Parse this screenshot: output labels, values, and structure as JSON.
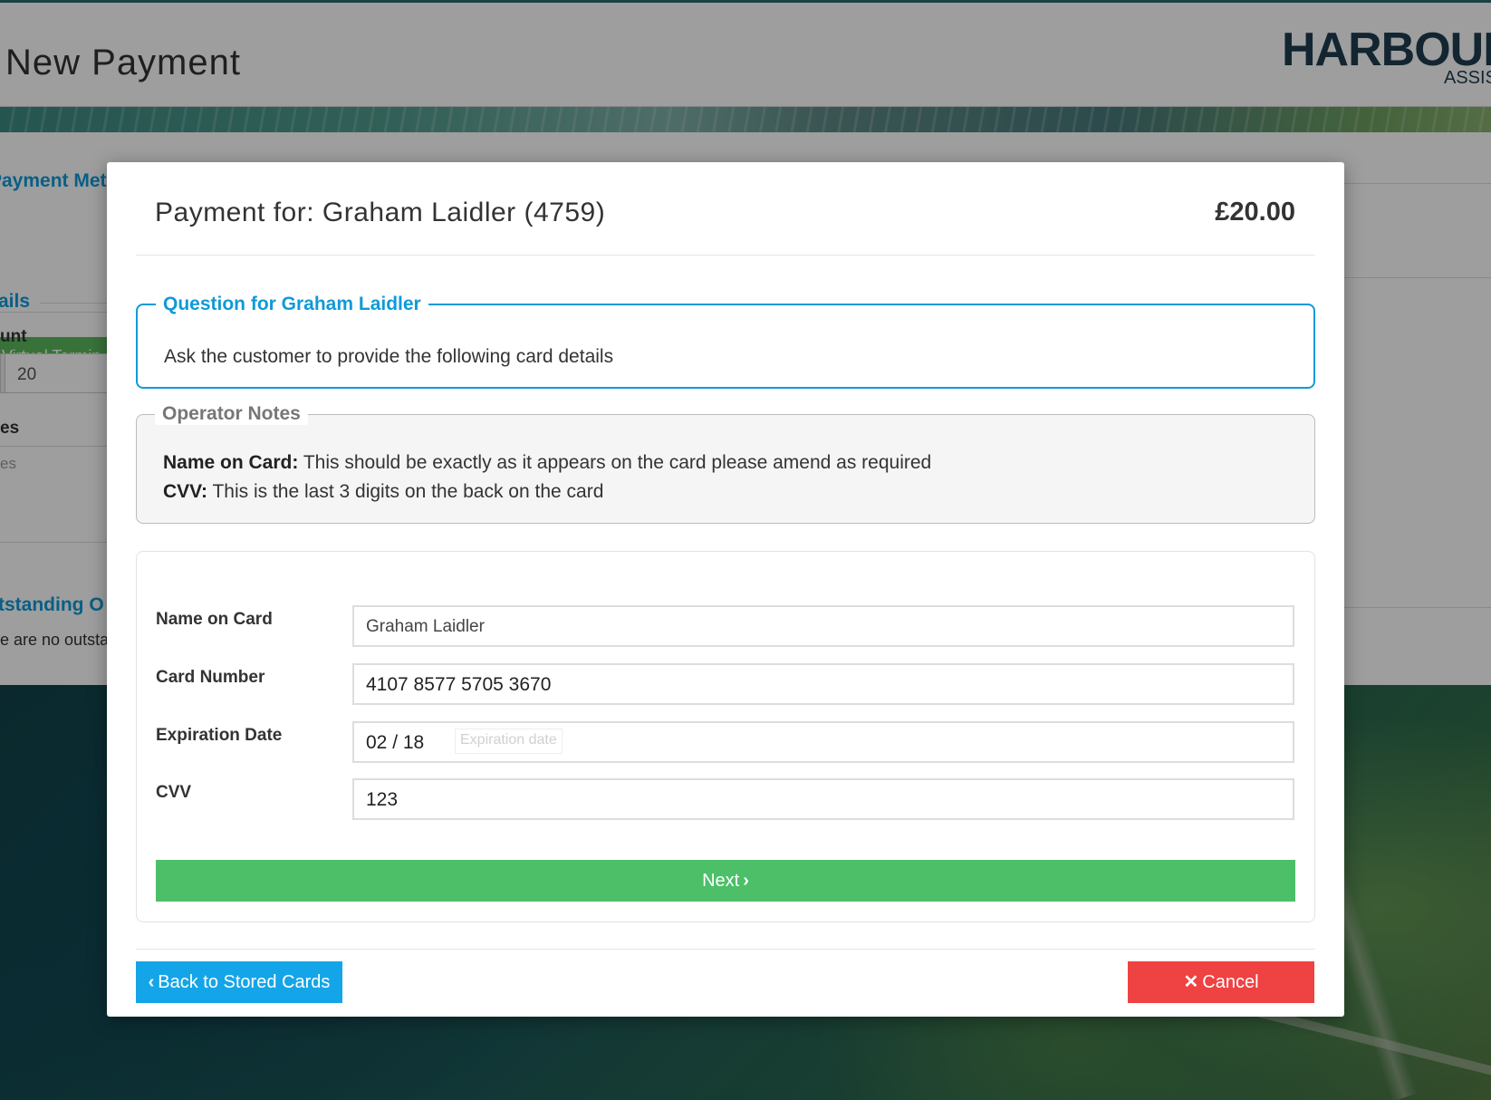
{
  "page": {
    "title": "New Payment",
    "logo_text": "HARBOUR",
    "logo_tagline": "ASSIST"
  },
  "background_panel": {
    "payment_method_heading": "Payment Meth",
    "virtual_terminal_button": "Virtual Termin",
    "details_heading": "ails",
    "amount_label": "unt",
    "amount_value": "20",
    "notes_label": "es",
    "notes_placeholder": "es",
    "outstanding_heading": "tstanding O",
    "outstanding_text": "e are no outsta"
  },
  "modal": {
    "title": "Payment for: Graham Laidler (4759)",
    "amount": "£20.00",
    "question": {
      "legend": "Question for Graham Laidler",
      "text": "Ask the customer to provide the following card details"
    },
    "operator_notes": {
      "legend": "Operator Notes",
      "lines": [
        {
          "label": "Name on Card:",
          "text": " This should be exactly as it appears on the card please amend as required"
        },
        {
          "label": "CVV:",
          "text": " This is the last 3 digits on the back on the card"
        }
      ]
    },
    "form": {
      "fields": {
        "name": {
          "label": "Name on Card",
          "value": "Graham Laidler"
        },
        "card_number": {
          "label": "Card Number",
          "value": "4107 8577 5705 3670"
        },
        "expiration": {
          "label": "Expiration Date",
          "value": "02 / 18",
          "tooltip": "Expiration date"
        },
        "cvv": {
          "label": "CVV",
          "value": "123"
        }
      },
      "next_button": "Next",
      "next_icon": "chevron-right-icon"
    },
    "footer": {
      "back_button": "Back to Stored Cards",
      "back_icon": "chevron-left-icon",
      "cancel_button": "Cancel",
      "cancel_icon": "close-icon"
    }
  },
  "colors": {
    "accent_blue": "#14a5e8",
    "next_green": "#4cbf68",
    "cancel_red": "#ef4242"
  }
}
